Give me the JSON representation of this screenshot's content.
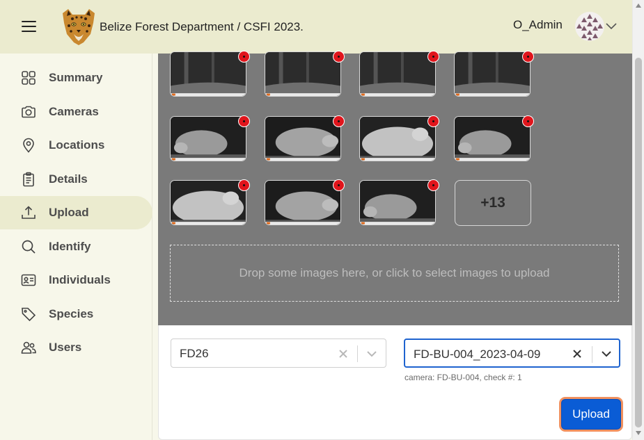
{
  "header": {
    "app_title": "Belize Forest Department / CSFI 2023.",
    "username": "O_Admin",
    "menu_icon": "hamburger-icon",
    "logo_icon": "jaguar-logo",
    "avatar_icon": "user-avatar",
    "dropdown_icon": "chevron-down-icon"
  },
  "sidebar": {
    "items": [
      {
        "label": "Summary",
        "icon": "grid-icon"
      },
      {
        "label": "Cameras",
        "icon": "camera-icon"
      },
      {
        "label": "Locations",
        "icon": "location-pin-icon"
      },
      {
        "label": "Details",
        "icon": "clipboard-icon"
      },
      {
        "label": "Upload",
        "icon": "upload-icon",
        "active": true
      },
      {
        "label": "Identify",
        "icon": "search-icon"
      },
      {
        "label": "Individuals",
        "icon": "id-card-icon"
      },
      {
        "label": "Species",
        "icon": "tag-icon"
      },
      {
        "label": "Users",
        "icon": "users-icon"
      }
    ]
  },
  "gallery": {
    "more_count": "+13",
    "dropzone_text": "Drop some images here, or click to select images to upload",
    "thumbnail_count_visible": 11
  },
  "form": {
    "location_select": {
      "value": "FD26"
    },
    "check_select": {
      "value": "FD-BU-004_2023-04-09",
      "hint": "camera: FD-BU-004, check #: 1"
    },
    "upload_label": "Upload"
  },
  "colors": {
    "topbar": "#ebebcf",
    "sidebar": "#f7f7ea",
    "gallery_bg": "#7a7a7a",
    "primary": "#0a5cd5",
    "focus_ring": "#f1915f",
    "badge": "#e0151c"
  }
}
